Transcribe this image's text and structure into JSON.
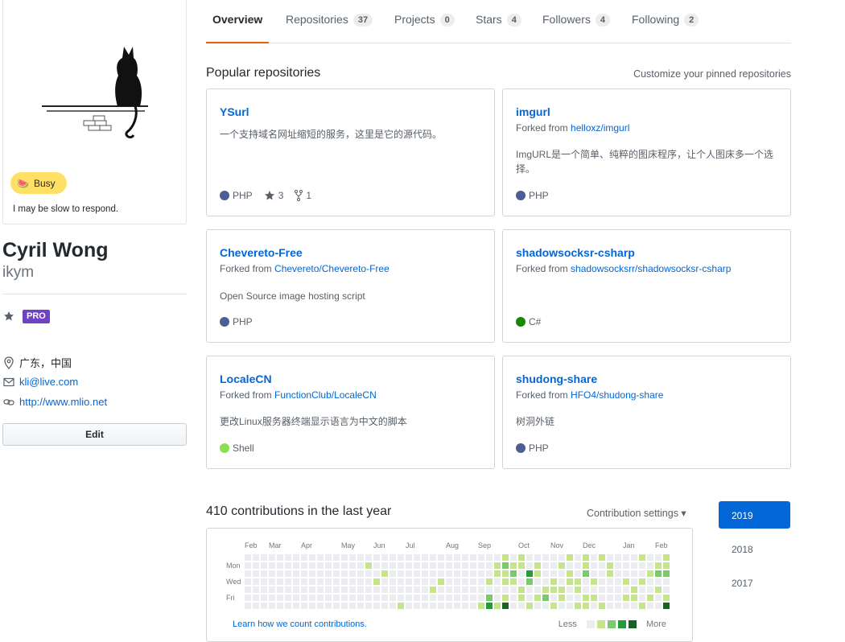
{
  "profile": {
    "status_emoji": "🍉",
    "status_label": "Busy",
    "status_message": "I may be slow to respond.",
    "name": "Cyril Wong",
    "login": "ikym",
    "pro_label": "PRO",
    "location": "广东，中国",
    "email": "kli@live.com",
    "url": "http://www.mlio.net",
    "edit_label": "Edit"
  },
  "tabs": [
    {
      "label": "Overview",
      "count": null
    },
    {
      "label": "Repositories",
      "count": "37"
    },
    {
      "label": "Projects",
      "count": "0"
    },
    {
      "label": "Stars",
      "count": "4"
    },
    {
      "label": "Followers",
      "count": "4"
    },
    {
      "label": "Following",
      "count": "2"
    }
  ],
  "pinned": {
    "title": "Popular repositories",
    "customize": "Customize your pinned repositories",
    "forked_prefix": "Forked from",
    "repos": [
      {
        "name": "YSurl",
        "forked_from": "",
        "description": "一个支持域名网址缩短的服务，这里是它的源代码。",
        "language": "PHP",
        "lang_color": "#4F5D95",
        "stars": "3",
        "forks": "1"
      },
      {
        "name": "imgurl",
        "forked_from": "helloxz/imgurl",
        "description": "ImgURL是一个简单、纯粹的图床程序，让个人图床多一个选择。",
        "language": "PHP",
        "lang_color": "#4F5D95"
      },
      {
        "name": "Chevereto-Free",
        "forked_from": "Chevereto/Chevereto-Free",
        "description": "Open Source image hosting script",
        "language": "PHP",
        "lang_color": "#4F5D95"
      },
      {
        "name": "shadowsocksr-csharp",
        "forked_from": "shadowsocksrr/shadowsocksr-csharp",
        "description": "",
        "language": "C#",
        "lang_color": "#178600"
      },
      {
        "name": "LocaleCN",
        "forked_from": "FunctionClub/LocaleCN",
        "description": "更改Linux服务器终端显示语言为中文的脚本",
        "language": "Shell",
        "lang_color": "#89e051"
      },
      {
        "name": "shudong-share",
        "forked_from": "HFO4/shudong-share",
        "description": "树洞外链",
        "language": "PHP",
        "lang_color": "#4F5D95"
      }
    ]
  },
  "contributions": {
    "title": "410 contributions in the last year",
    "settings_label": "Contribution settings ▾",
    "months": [
      "Feb",
      "Mar",
      "Apr",
      "May",
      "Jun",
      "Jul",
      "Aug",
      "Sep",
      "Oct",
      "Nov",
      "Dec",
      "Jan",
      "Feb"
    ],
    "days": [
      "Mon",
      "Wed",
      "Fri"
    ],
    "learn_link": "Learn how we count contributions.",
    "less": "Less",
    "more": "More",
    "colors": [
      "#ebedf0",
      "#c6e48b",
      "#7bc96f",
      "#239a3b",
      "#196127"
    ],
    "week_count": 53,
    "levels": {
      "15-1": 1,
      "16-3": 1,
      "17-2": 1,
      "19-6": 1,
      "23-4": 1,
      "24-3": 1,
      "29-6": 1,
      "29-7": 1,
      "30-3": 1,
      "30-5": 2,
      "30-6": 3,
      "30-7": 2,
      "31-1": 1,
      "31-2": 1,
      "31-6": 1,
      "32-0": 1,
      "32-1": 2,
      "32-2": 1,
      "32-3": 1,
      "32-5": 1,
      "32-6": 4,
      "33-1": 1,
      "33-2": 2,
      "33-3": 1,
      "34-0": 1,
      "34-1": 1,
      "34-4": 1,
      "34-5": 1,
      "35-2": 3,
      "35-3": 2,
      "35-6": 1,
      "36-1": 1,
      "36-2": 1,
      "36-5": 1,
      "37-4": 1,
      "37-5": 2,
      "38-3": 1,
      "38-4": 1,
      "38-6": 1,
      "39-1": 1,
      "39-4": 1,
      "39-5": 1,
      "40-0": 1,
      "40-2": 1,
      "40-3": 1,
      "41-3": 1,
      "41-4": 1,
      "41-6": 1,
      "42-0": 1,
      "42-1": 1,
      "42-2": 2,
      "42-5": 1,
      "42-6": 1,
      "43-3": 1,
      "43-5": 1,
      "44-0": 1,
      "44-6": 1,
      "45-1": 1,
      "45-2": 1,
      "47-3": 1,
      "47-5": 1,
      "48-4": 1,
      "48-5": 1,
      "49-0": 1,
      "49-3": 1,
      "49-6": 1,
      "50-2": 1,
      "50-5": 1,
      "51-1": 1,
      "51-2": 2,
      "51-4": 1,
      "52-0": 1,
      "52-1": 1,
      "52-2": 2,
      "52-5": 1,
      "52-6": 4
    }
  },
  "years": [
    "2019",
    "2018",
    "2017"
  ]
}
